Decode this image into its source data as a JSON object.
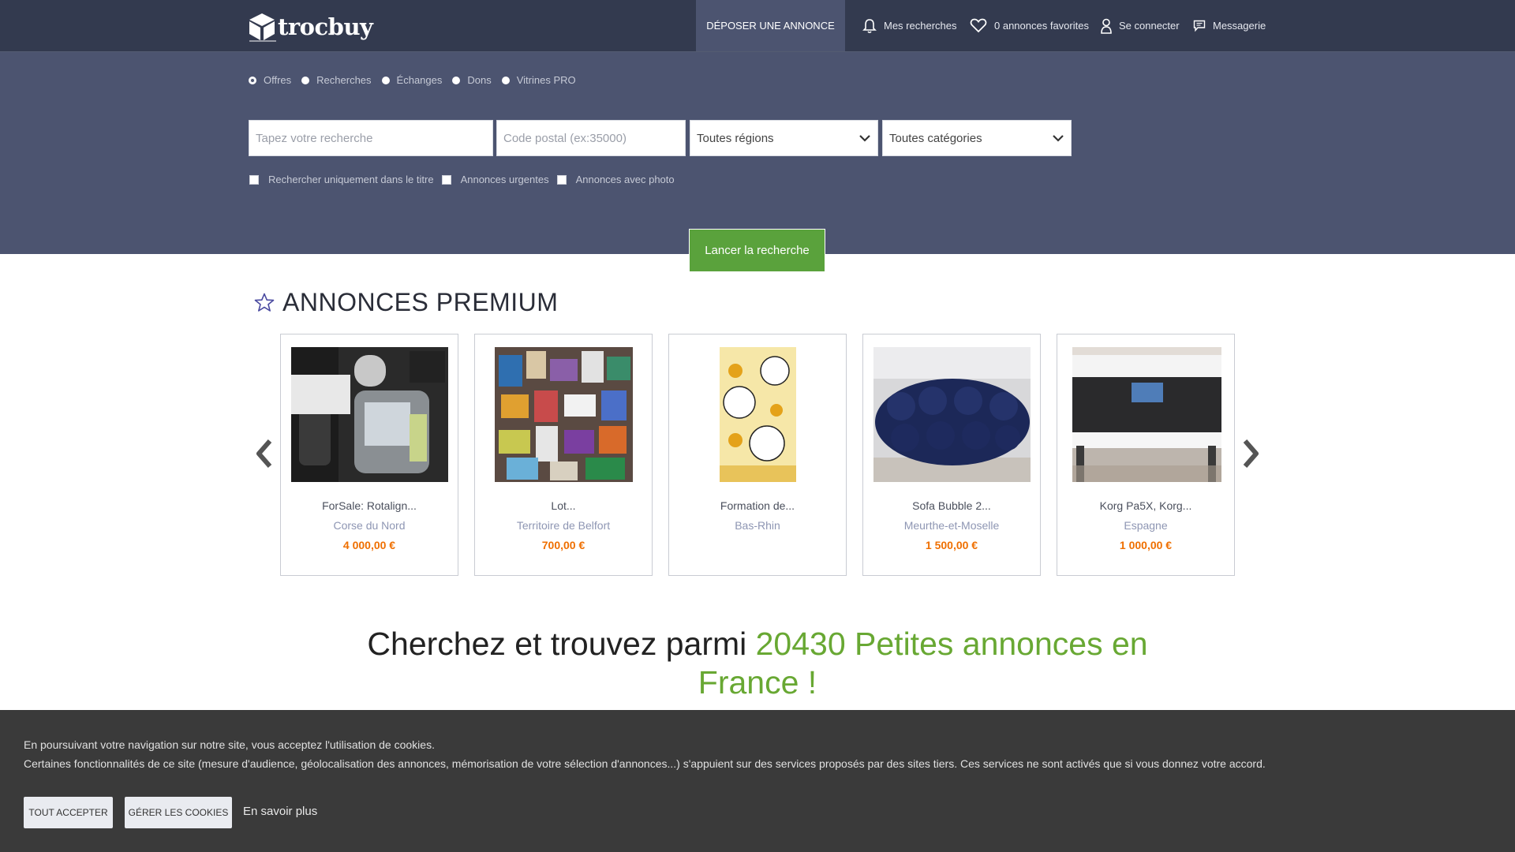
{
  "header": {
    "logo_text": "trocbuy",
    "deposit_label": "DÉPOSER UNE ANNONCE",
    "nav": {
      "searches": "Mes recherches",
      "favorites": "0 annonces favorites",
      "login": "Se connecter",
      "messages": "Messagerie"
    }
  },
  "search": {
    "types": [
      "Offres",
      "Recherches",
      "Échanges",
      "Dons",
      "Vitrines PRO"
    ],
    "query_placeholder": "Tapez votre recherche",
    "postal_placeholder": "Code postal (ex:35000)",
    "region": "Toutes régions",
    "category": "Toutes catégories",
    "checkboxes": [
      "Rechercher uniquement dans le titre",
      "Annonces urgentes",
      "Annonces avec photo"
    ],
    "submit_label": "Lancer la recherche"
  },
  "premium": {
    "title": "ANNONCES PREMIUM",
    "items": [
      {
        "title": "ForSale: Rotalign...",
        "location": "Corse du Nord",
        "price": "4 000,00 €"
      },
      {
        "title": "Lot...",
        "location": "Territoire de Belfort",
        "price": "700,00 €"
      },
      {
        "title": "Formation de...",
        "location": "Bas-Rhin",
        "price": ""
      },
      {
        "title": "Sofa Bubble 2...",
        "location": "Meurthe-et-Moselle",
        "price": "1 500,00 €"
      },
      {
        "title": "Korg Pa5X, Korg...",
        "location": "Espagne",
        "price": "1 000,00 €"
      }
    ]
  },
  "headline": {
    "prefix": "Cherchez et trouvez parmi ",
    "highlight": "20430 Petites annonces en France !"
  },
  "cookies": {
    "line1": "En poursuivant votre navigation sur notre site, vous acceptez l'utilisation de cookies.",
    "line2": "Certaines fonctionnalités de ce site (mesure d'audience, géolocalisation des annonces, mémorisation de votre sélection d'annonces...) s'appuient sur des services proposés par des sites tiers. Ces services ne sont activés que si vous donnez votre accord.",
    "accept_label": "TOUT ACCEPTER",
    "manage_label": "GÉRER LES COOKIES",
    "more_label": "En savoir plus"
  },
  "colors": {
    "header_bg": "#333a4f",
    "search_bg": "#4c5470",
    "button_green": "#5aa23c",
    "price_orange": "#ef6f00",
    "headline_green": "#68a833"
  }
}
